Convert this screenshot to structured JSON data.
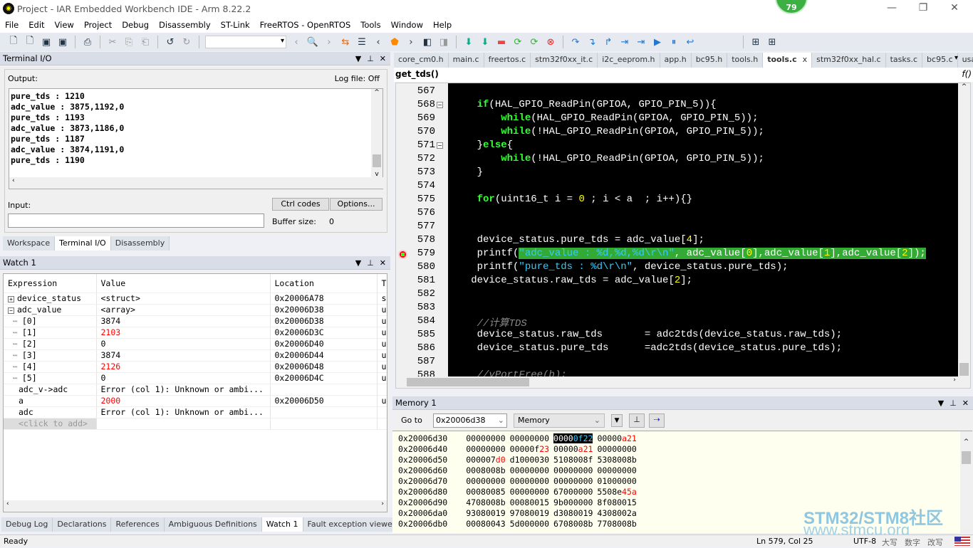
{
  "window": {
    "title": "Project - IAR Embedded Workbench IDE - Arm 8.22.2",
    "badge": "79"
  },
  "menu": [
    "File",
    "Edit",
    "View",
    "Project",
    "Debug",
    "Disassembly",
    "ST-Link",
    "FreeRTOS - OpenRTOS",
    "Tools",
    "Window",
    "Help"
  ],
  "terminal": {
    "title": "Terminal I/O",
    "output_label": "Output:",
    "log_file": "Log file: Off",
    "lines": [
      "pure_tds : 1210",
      "adc_value : 3875,1192,0",
      "pure_tds : 1193",
      "adc_value : 3873,1186,0",
      "pure_tds : 1187",
      "adc_value : 3874,1191,0",
      "pure_tds : 1190"
    ],
    "input_label": "Input:",
    "ctrl_codes": "Ctrl codes",
    "options": "Options...",
    "buffer_label": "Buffer size:",
    "buffer_value": "0",
    "input_value": ""
  },
  "left_tabs": [
    "Workspace",
    "Terminal I/O",
    "Disassembly"
  ],
  "watch": {
    "title": "Watch 1",
    "columns": [
      "Expression",
      "Value",
      "Location",
      "T"
    ],
    "rows": [
      {
        "expr": "device_status",
        "value": "<struct>",
        "loc": "0x20006A78",
        "t": "s",
        "tree": "plus",
        "changed": false
      },
      {
        "expr": "adc_value",
        "value": "<array>",
        "loc": "0x20006D38",
        "t": "u",
        "tree": "minus",
        "changed": false
      },
      {
        "expr": "[0]",
        "value": "3874",
        "loc": "0x20006D38",
        "t": "u",
        "tree": "child",
        "changed": false
      },
      {
        "expr": "[1]",
        "value": "2103",
        "loc": "0x20006D3C",
        "t": "u",
        "tree": "child",
        "changed": true
      },
      {
        "expr": "[2]",
        "value": "0",
        "loc": "0x20006D40",
        "t": "u",
        "tree": "child",
        "changed": false
      },
      {
        "expr": "[3]",
        "value": "3874",
        "loc": "0x20006D44",
        "t": "u",
        "tree": "child",
        "changed": false
      },
      {
        "expr": "[4]",
        "value": "2126",
        "loc": "0x20006D48",
        "t": "u",
        "tree": "child",
        "changed": true
      },
      {
        "expr": "[5]",
        "value": "0",
        "loc": "0x20006D4C",
        "t": "u",
        "tree": "last",
        "changed": false
      },
      {
        "expr": "adc_v->adc",
        "value": "Error (col 1): Unknown or ambi...",
        "loc": "",
        "t": "",
        "tree": "none",
        "changed": false
      },
      {
        "expr": "a",
        "value": "2000",
        "loc": "0x20006D50",
        "t": "u",
        "tree": "none",
        "changed": true
      },
      {
        "expr": "adc",
        "value": "Error (col 1): Unknown or ambi...",
        "loc": "",
        "t": "",
        "tree": "none",
        "changed": false
      }
    ],
    "add_placeholder": "<click to add>"
  },
  "bottom_tabs": [
    "Debug Log",
    "Declarations",
    "References",
    "Ambiguous Definitions",
    "Watch 1",
    "Fault exception viewer"
  ],
  "bottom_active": 4,
  "editor": {
    "tabs": [
      "core_cm0.h",
      "main.c",
      "freertos.c",
      "stm32f0xx_it.c",
      "i2c_eeprom.h",
      "app.h",
      "bc95.h",
      "tools.h",
      "tools.c",
      "stm32f0xx_hal.c",
      "tasks.c",
      "bc95.c",
      "usart.c"
    ],
    "active_tab": 8,
    "function": "get_tds()",
    "current_line": 579,
    "lines": [
      {
        "n": "567",
        "fold": "",
        "t": []
      },
      {
        "n": "568",
        "fold": "box",
        "t": [
          [
            "    ",
            ""
          ],
          [
            "if",
            "kw"
          ],
          [
            "(HAL_GPIO_ReadPin(GPIOA, GPIO_PIN_5)){",
            ""
          ]
        ]
      },
      {
        "n": "569",
        "fold": "",
        "t": [
          [
            "        ",
            ""
          ],
          [
            "while",
            "kw"
          ],
          [
            "(HAL_GPIO_ReadPin(GPIOA, GPIO_PIN_5));",
            ""
          ]
        ]
      },
      {
        "n": "570",
        "fold": "",
        "t": [
          [
            "        ",
            ""
          ],
          [
            "while",
            "kw"
          ],
          [
            "(!HAL_GPIO_ReadPin(GPIOA, GPIO_PIN_5));",
            ""
          ]
        ]
      },
      {
        "n": "571",
        "fold": "box",
        "t": [
          [
            "    }",
            ""
          ],
          [
            "else",
            "kw"
          ],
          [
            "{",
            ""
          ]
        ]
      },
      {
        "n": "572",
        "fold": "",
        "t": [
          [
            "        ",
            ""
          ],
          [
            "while",
            "kw"
          ],
          [
            "(!HAL_GPIO_ReadPin(GPIOA, GPIO_PIN_5));",
            ""
          ]
        ]
      },
      {
        "n": "573",
        "fold": "",
        "t": [
          [
            "    }",
            ""
          ]
        ]
      },
      {
        "n": "574",
        "fold": "",
        "t": []
      },
      {
        "n": "575",
        "fold": "",
        "t": [
          [
            "    ",
            ""
          ],
          [
            "for",
            "kw"
          ],
          [
            "(uint16_t i = ",
            ""
          ],
          [
            "0",
            "num"
          ],
          [
            " ; i < a  ; i++){}",
            ""
          ]
        ]
      },
      {
        "n": "576",
        "fold": "",
        "t": []
      },
      {
        "n": "577",
        "fold": "",
        "t": []
      },
      {
        "n": "578",
        "fold": "",
        "t": [
          [
            "    device_status.pure_tds = adc_value[",
            ""
          ],
          [
            "4",
            "num"
          ],
          [
            "];",
            ""
          ]
        ]
      },
      {
        "n": "579",
        "fold": "",
        "t": [
          [
            "    printf(",
            ""
          ],
          [
            "\"adc_value : %d,%d,%d\\r\\n\"",
            "str"
          ],
          [
            ", adc_value[",
            ""
          ],
          [
            "0",
            "num"
          ],
          [
            "],adc_value[",
            ""
          ],
          [
            "1",
            "num"
          ],
          [
            "],adc_value[",
            ""
          ],
          [
            "2",
            "num"
          ],
          [
            "]);",
            ""
          ]
        ]
      },
      {
        "n": "580",
        "fold": "",
        "t": [
          [
            "    printf(",
            ""
          ],
          [
            "\"pure_tds : %d\\r\\n\"",
            "str"
          ],
          [
            ", device_status.pure_tds);",
            ""
          ]
        ]
      },
      {
        "n": "581",
        "fold": "",
        "t": [
          [
            "   device_status.raw_tds = adc_value[",
            ""
          ],
          [
            "2",
            "num"
          ],
          [
            "];",
            ""
          ]
        ]
      },
      {
        "n": "582",
        "fold": "",
        "t": []
      },
      {
        "n": "583",
        "fold": "",
        "t": []
      },
      {
        "n": "584",
        "fold": "",
        "t": [
          [
            "    ",
            ""
          ],
          [
            "//计算TDS",
            "cm"
          ]
        ]
      },
      {
        "n": "585",
        "fold": "",
        "t": [
          [
            "    device_status.raw_tds       = adc2tds(device_status.raw_tds);",
            ""
          ]
        ]
      },
      {
        "n": "586",
        "fold": "",
        "t": [
          [
            "    device_status.pure_tds      =adc2tds(device_status.pure_tds);",
            ""
          ]
        ]
      },
      {
        "n": "587",
        "fold": "",
        "t": []
      },
      {
        "n": "588",
        "fold": "",
        "t": [
          [
            "    ",
            ""
          ],
          [
            "//vPortFree(b);",
            "cm"
          ]
        ]
      }
    ]
  },
  "memory": {
    "title": "Memory 1",
    "goto_label": "Go to",
    "goto_value": "0x20006d38",
    "zone": "Memory",
    "rows": [
      [
        "0x20006d30",
        "00000000",
        "00000000",
        "00000f22",
        "00000a21"
      ],
      [
        "0x20006d40",
        "00000000",
        "00000f23",
        "00000a21",
        "00000000"
      ],
      [
        "0x20006d50",
        "000007d0",
        "d1000030",
        "5108008f",
        "5308008b"
      ],
      [
        "0x20006d60",
        "0008008b",
        "00000000",
        "00000000",
        "00000000"
      ],
      [
        "0x20006d70",
        "00000000",
        "00000000",
        "00000000",
        "01000000"
      ],
      [
        "0x20006d80",
        "00080085",
        "00000000",
        "67000000",
        "5508e45a"
      ],
      [
        "0x20006d90",
        "4708008b",
        "00080015",
        "9b000000",
        "8f080015"
      ],
      [
        "0x20006da0",
        "93080019",
        "97080019",
        "d3080019",
        "4308002a"
      ],
      [
        "0x20006db0",
        "00080043",
        "5d000000",
        "6708008b",
        "7708008b"
      ]
    ],
    "changed": {
      "0-3": 4,
      "0-4": 3,
      "1-2": 2,
      "1-3": 3,
      "2-1": 2,
      "5-4": 3
    }
  },
  "watermark": {
    "line1": "STM32/STM8社区",
    "line2": "www.stmcu.org"
  },
  "status": {
    "left": "Ready",
    "position": "Ln 579, Col 25",
    "encoding": "UTF-8",
    "caps": "大写",
    "num": "数字",
    "ovr": "改写"
  }
}
